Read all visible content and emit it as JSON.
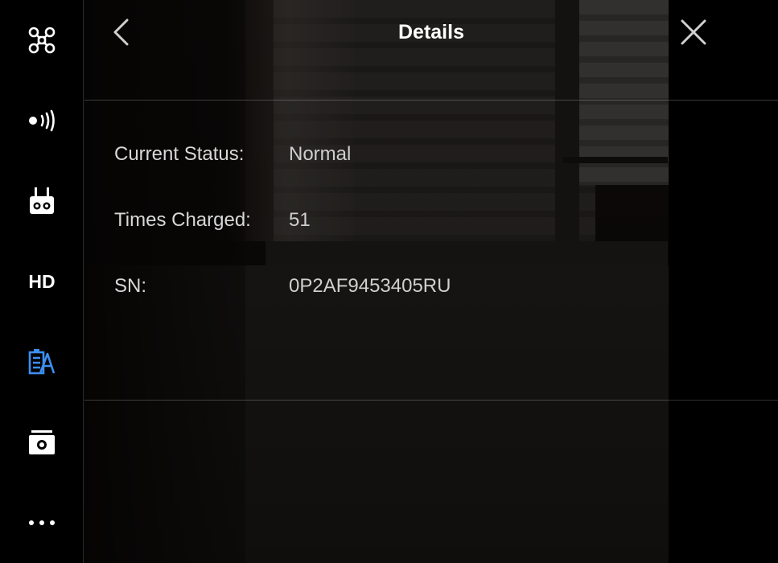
{
  "header": {
    "title": "Details",
    "back_icon": "chevron-left-icon",
    "close_icon": "close-icon"
  },
  "sidebar": {
    "items": [
      {
        "icon": "aircraft-icon"
      },
      {
        "icon": "signal-icon"
      },
      {
        "icon": "remote-controller-icon"
      },
      {
        "icon": "hd-transmission-icon",
        "label": "HD"
      },
      {
        "icon": "battery-icon",
        "active": true
      },
      {
        "icon": "camera-icon"
      },
      {
        "icon": "more-icon"
      }
    ]
  },
  "details": {
    "rows": [
      {
        "label": "Current Status:",
        "value": "Normal"
      },
      {
        "label": "Times Charged:",
        "value": "51"
      },
      {
        "label": "SN:",
        "value": "0P2AF9453405RU"
      }
    ]
  },
  "colors": {
    "accent": "#3d8ef0",
    "text": "#ffffff",
    "muted_text": "#d0d0d0"
  }
}
